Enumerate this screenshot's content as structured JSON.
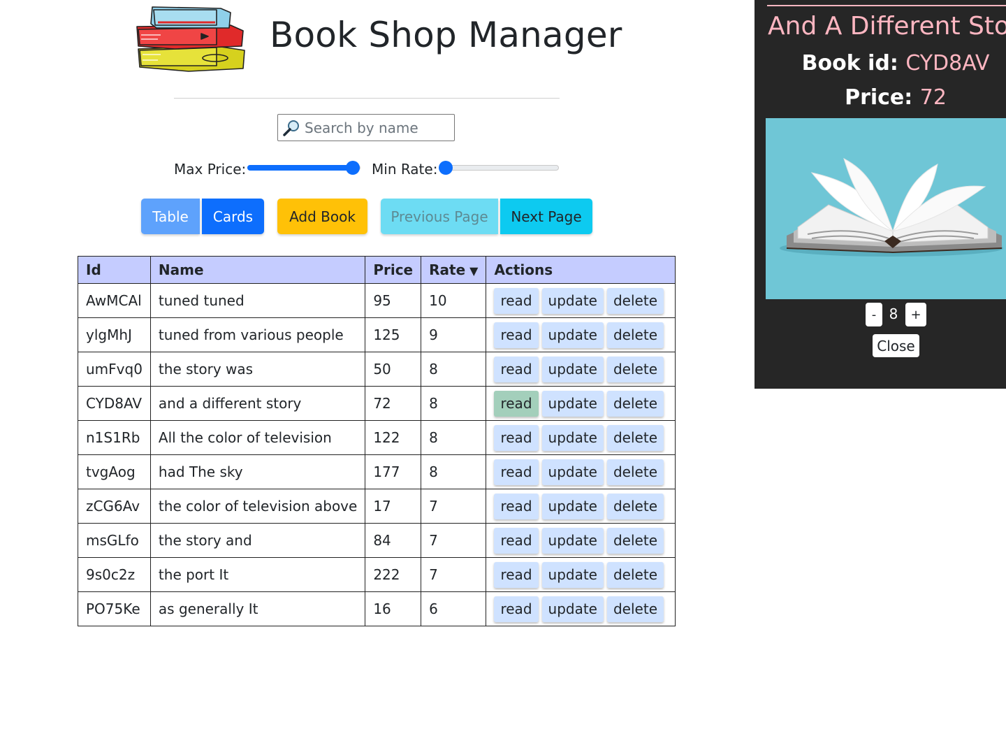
{
  "header": {
    "title": "Book Shop Manager",
    "logo_icon": "book-stack-icon"
  },
  "search": {
    "placeholder": "Search by name",
    "value": "",
    "icon": "magnifier-icon"
  },
  "filters": {
    "max_price_label": "Max Price:",
    "max_price_fraction": 0.93,
    "min_rate_label": "Min Rate:",
    "min_rate_fraction": 0.0
  },
  "toolbar": {
    "table_label": "Table",
    "cards_label": "Cards",
    "add_label": "Add Book",
    "prev_label": "Previous Page",
    "next_label": "Next Page"
  },
  "table": {
    "headers": {
      "id": "Id",
      "name": "Name",
      "price": "Price",
      "rate": "Rate",
      "actions": "Actions"
    },
    "sort_indicator": "▼",
    "action_labels": {
      "read": "read",
      "update": "update",
      "delete": "delete"
    },
    "rows": [
      {
        "id": "AwMCAl",
        "name": "tuned tuned",
        "price": "95",
        "rate": "10"
      },
      {
        "id": "ylgMhJ",
        "name": "tuned from various people",
        "price": "125",
        "rate": "9"
      },
      {
        "id": "umFvq0",
        "name": "the story was",
        "price": "50",
        "rate": "8"
      },
      {
        "id": "CYD8AV",
        "name": "and a different story",
        "price": "72",
        "rate": "8"
      },
      {
        "id": "n1S1Rb",
        "name": "All the color of television",
        "price": "122",
        "rate": "8"
      },
      {
        "id": "tvgAog",
        "name": "had The sky",
        "price": "177",
        "rate": "8"
      },
      {
        "id": "zCG6Av",
        "name": "the color of television above",
        "price": "17",
        "rate": "7"
      },
      {
        "id": "msGLfo",
        "name": "the story and",
        "price": "84",
        "rate": "7"
      },
      {
        "id": "9s0c2z",
        "name": "the port It",
        "price": "222",
        "rate": "7"
      },
      {
        "id": "PO75Ke",
        "name": "as generally It",
        "price": "16",
        "rate": "6"
      }
    ]
  },
  "panel": {
    "title": "And A Different Stor",
    "book_id_label": "Book id:",
    "book_id_value": "CYD8AV",
    "price_label": "Price:",
    "price_value": "72",
    "image_icon": "open-book-icon",
    "minus_label": "-",
    "quantity": "8",
    "plus_label": "+",
    "close_label": "Close"
  },
  "colors": {
    "primary": "#0d6efd",
    "warning": "#ffc107",
    "info": "#0dcaf0",
    "header_bg": "#c5ccff",
    "action_bg": "#cfe2ff",
    "active_action_bg": "#a3cfbb",
    "panel_bg": "#262626",
    "panel_accent": "#ffb6c1"
  }
}
